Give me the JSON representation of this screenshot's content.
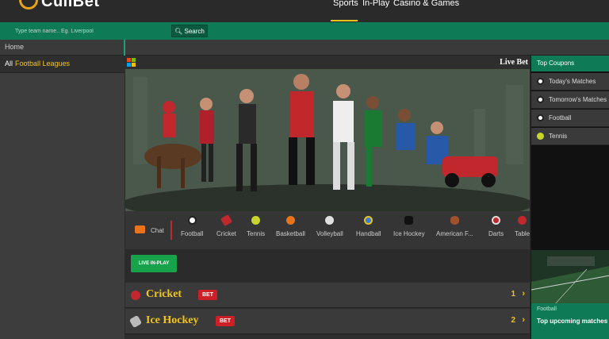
{
  "header": {
    "logo_text": "CuiiBet",
    "nav": [
      {
        "label": "Sports",
        "active": true
      },
      {
        "label": "In-Play",
        "active": false
      },
      {
        "label": "Casino & Games",
        "active": false
      }
    ]
  },
  "search": {
    "placeholder": "Type team name.. Eg. Liverpool",
    "button_label": "Search"
  },
  "breadcrumb": {
    "home_label": "Home"
  },
  "sidebar": {
    "all_label": "All",
    "leagues_label": "Football Leagues"
  },
  "main": {
    "live_bet_label": "Live Bet",
    "chat_label": "Chat",
    "sports": [
      {
        "label": "Football",
        "icon": "football-icon",
        "color": "#ffffff"
      },
      {
        "label": "Cricket",
        "icon": "cricket-icon",
        "color": "#c0282d"
      },
      {
        "label": "Tennis",
        "icon": "tennis-icon",
        "color": "#c8d62b"
      },
      {
        "label": "Basketball",
        "icon": "basketball-icon",
        "color": "#e8731a"
      },
      {
        "label": "Volleyball",
        "icon": "volleyball-icon",
        "color": "#e0e0e0"
      },
      {
        "label": "Handball",
        "icon": "handball-icon",
        "color": "#3a7bd5"
      },
      {
        "label": "Ice Hockey",
        "icon": "ice-hockey-icon",
        "color": "#222222"
      },
      {
        "label": "American F...",
        "icon": "american-football-icon",
        "color": "#a0522d"
      },
      {
        "label": "Darts",
        "icon": "darts-icon",
        "color": "#c0282d"
      },
      {
        "label": "Table",
        "icon": "table-tennis-icon",
        "color": "#c0282d"
      }
    ],
    "live_in_play_label": "LIVE IN-PLAY",
    "rows": [
      {
        "name": "Cricket",
        "bet_label": "BET",
        "count": "1",
        "icon": "cricket-ball-icon",
        "color": "#c0282d"
      },
      {
        "name": "Ice Hockey",
        "bet_label": "BET",
        "count": "2",
        "icon": "ice-hockey-icon",
        "color": "#bbbbbb"
      }
    ]
  },
  "coupons": {
    "title": "Top Coupons",
    "items": [
      {
        "label": "Today's Matches",
        "icon": "football-icon"
      },
      {
        "label": "Tomorrow's Matches",
        "icon": "football-icon"
      },
      {
        "label": "Football",
        "icon": "football-icon"
      },
      {
        "label": "Tennis",
        "icon": "tennis-icon"
      }
    ],
    "promo_category": "Football",
    "promo_title": "Top upcoming matches"
  },
  "colors": {
    "brand_green": "#0f7a56",
    "accent_yellow": "#f0c419",
    "bet_red": "#cc1f26",
    "live_green": "#17a34a"
  }
}
